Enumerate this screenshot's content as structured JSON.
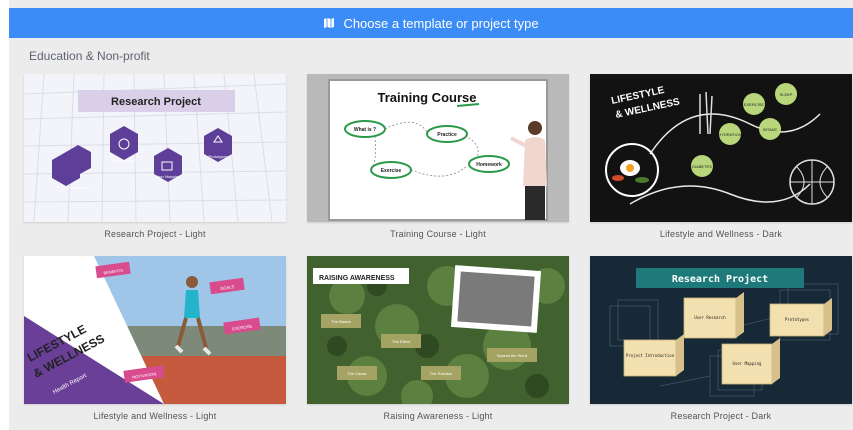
{
  "header": {
    "title": "Choose a template or project type",
    "icon": "template-icon"
  },
  "section": {
    "title": "Education & Non-profit"
  },
  "templates": [
    {
      "caption": "Research Project - Light",
      "title": "Research Project",
      "nodes": [
        "Project Introduction",
        "User Research",
        "User Mapping",
        "Prototypes"
      ]
    },
    {
      "caption": "Training Course - Light",
      "title": "Training Course",
      "nodes": [
        "What is ?",
        "Practice",
        "Exercise",
        "Homework"
      ]
    },
    {
      "caption": "Lifestyle and Wellness - Dark",
      "title_line1": "LIFESTYLE",
      "title_line2": "& WELLNESS",
      "nodes": [
        "SLEEP",
        "EXERCISE",
        "HYDRATION",
        "INTAKE",
        "DIABETES"
      ]
    },
    {
      "caption": "Lifestyle and Wellness - Light",
      "title_line1": "LIFESTYLE",
      "title_line2": "& WELLNESS",
      "subtitle": "Health Report",
      "nodes": [
        "BENEFITS",
        "GOALS",
        "EXERCISE",
        "MOTIVATION"
      ]
    },
    {
      "caption": "Raising Awareness - Light",
      "title": "RAISING AWARENESS",
      "nodes": [
        "The Basics",
        "The Effect",
        "The Cause",
        "The Solution",
        "Spread the Word"
      ]
    },
    {
      "caption": "Research Project - Dark",
      "title": "Research Project",
      "nodes": [
        "Project Introduction",
        "User Research",
        "User Mapping",
        "Prototypes"
      ]
    }
  ]
}
